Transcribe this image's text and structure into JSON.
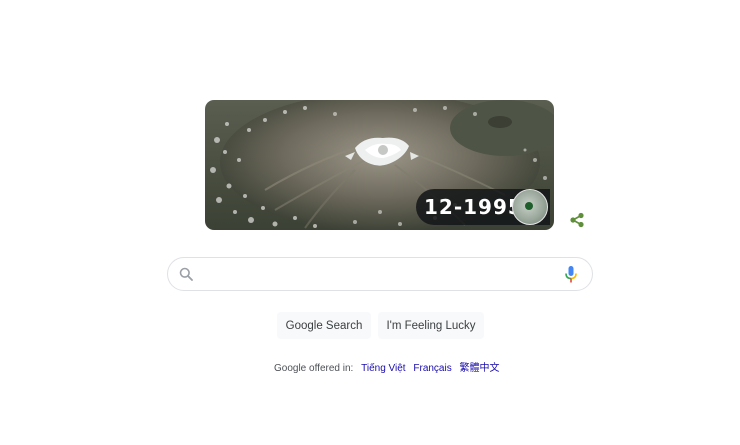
{
  "doodle": {
    "date": "12-1995"
  },
  "search": {
    "value": "",
    "placeholder": ""
  },
  "buttons": {
    "search": "Google Search",
    "lucky": "I'm Feeling Lucky"
  },
  "languages": {
    "prefix": "Google offered in:",
    "items": [
      "Tiếng Việt",
      "Français",
      "繁體中文"
    ]
  },
  "icons": {
    "search": "search-icon",
    "mic": "mic-icon",
    "share": "share-icon",
    "globe": "globe-icon"
  },
  "colors": {
    "share": "#5f8f3a",
    "link": "#1a0dab",
    "mic_blue": "#4285f4",
    "mic_red": "#ea4335",
    "mic_yellow": "#fbbc04",
    "mic_green": "#34a853"
  }
}
